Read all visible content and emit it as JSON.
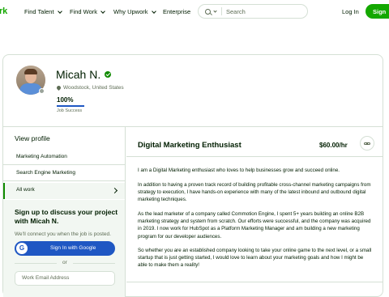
{
  "nav": {
    "logo": "rk",
    "links": [
      "Find Talent",
      "Find Work",
      "Why Upwork",
      "Enterprise"
    ],
    "search_placeholder": "Search",
    "login": "Log In",
    "signup": "Sign"
  },
  "profile": {
    "name": "Micah N.",
    "location": "Woodstock, United States",
    "job_success_value": "100%",
    "job_success_label": "Job Success",
    "job_success_fraction": 1.0
  },
  "sidebar": {
    "view_profile": "View profile",
    "items": [
      "Marketing Automation",
      "Search Engine Marketing",
      "All work"
    ],
    "cta_title": "Sign up to discuss your project with Micah N.",
    "cta_sub": "We'll connect you when the job is posted.",
    "google_button": "Sign In with Google",
    "or": "or",
    "email_placeholder": "Work Email Address"
  },
  "main": {
    "title": "Digital Marketing Enthusiast",
    "rate": "$60.00/hr",
    "paragraphs": [
      "I am a Digital Marketing enthusiast who loves to help businesses grow and succeed online.",
      "In addition to having a proven track record of building profitable cross-channel marketing campaigns from strategy to execution, I have hands-on experience with many of the latest inbound and outbound digital marketing techniques.",
      "As the lead marketer of a company called Commotion Engine, I spent 5+ years building an online B2B marketing strategy and system from scratch. Our efforts were successful, and the company was acquired in 2019. I now work for HubSpot as a Platform Marketing Manager and am building a new marketing program for our developer audiences.",
      "So whether you are an established company looking to take your online game to the next level, or a small startup that is just getting started, I would love to learn about your marketing goals and how I might be able to make them a reality!"
    ]
  },
  "colors": {
    "brand": "#14a800",
    "verified": "#108a00",
    "google_button": "#1f57c3",
    "text": "#001e00",
    "muted": "#5e6d55"
  }
}
